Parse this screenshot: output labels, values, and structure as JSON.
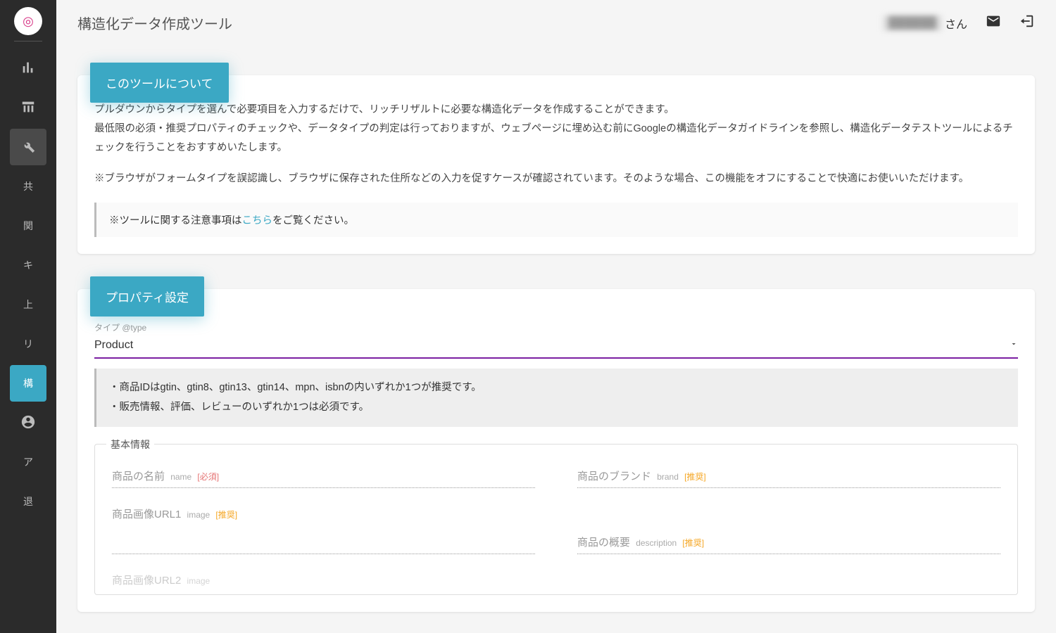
{
  "header": {
    "page_title": "構造化データ作成ツール",
    "user_suffix": "さん",
    "user_name_blurred": "██████"
  },
  "sidebar": {
    "items": [
      {
        "type": "icon",
        "name": "chart-bar-icon"
      },
      {
        "type": "icon",
        "name": "calendar-bar-icon"
      },
      {
        "type": "icon",
        "name": "wrench-icon",
        "activeTool": true
      },
      {
        "type": "text",
        "label": "共"
      },
      {
        "type": "text",
        "label": "関"
      },
      {
        "type": "text",
        "label": "キ"
      },
      {
        "type": "text",
        "label": "上"
      },
      {
        "type": "text",
        "label": "リ"
      },
      {
        "type": "text",
        "label": "構",
        "active": true
      },
      {
        "type": "icon",
        "name": "user-circle-icon"
      },
      {
        "type": "text",
        "label": "ア"
      },
      {
        "type": "text",
        "label": "退"
      }
    ]
  },
  "about_card": {
    "badge": "このツールについて",
    "paragraph1": "プルダウンからタイプを選んで必要項目を入力するだけで、リッチリザルトに必要な構造化データを作成することができます。",
    "paragraph2": "最低限の必須・推奨プロパティのチェックや、データタイプの判定は行っておりますが、ウェブページに埋め込む前にGoogleの構造化データガイドラインを参照し、構造化データテストツールによるチェックを行うことをおすすめいたします。",
    "paragraph3": "※ブラウザがフォームタイプを誤認識し、ブラウザに保存された住所などの入力を促すケースが確認されています。そのような場合、この機能をオフにすることで快適にお使いいただけます。",
    "note_prefix": "※ツールに関する注意事項は",
    "note_link": "こちら",
    "note_suffix": "をご覧ください。"
  },
  "property_card": {
    "badge": "プロパティ設定",
    "type_label": "タイプ @type",
    "type_value": "Product",
    "info_line1": "・商品IDはgtin、gtin8、gtin13、gtin14、mpn、isbnの内いずれか1つが推奨です。",
    "info_line2": "・販売情報、評価、レビューのいずれか1つは必須です。",
    "basic_legend": "基本情報",
    "fields": {
      "name_label": "商品の名前",
      "name_sub": "name",
      "name_tag": "[必須]",
      "brand_label": "商品のブランド",
      "brand_sub": "brand",
      "brand_tag": "[推奨]",
      "image1_label": "商品画像URL1",
      "image1_sub": "image",
      "image1_tag": "[推奨]",
      "desc_label": "商品の概要",
      "desc_sub": "description",
      "desc_tag": "[推奨]",
      "image2_label": "商品画像URL2",
      "image2_sub": "image"
    }
  }
}
